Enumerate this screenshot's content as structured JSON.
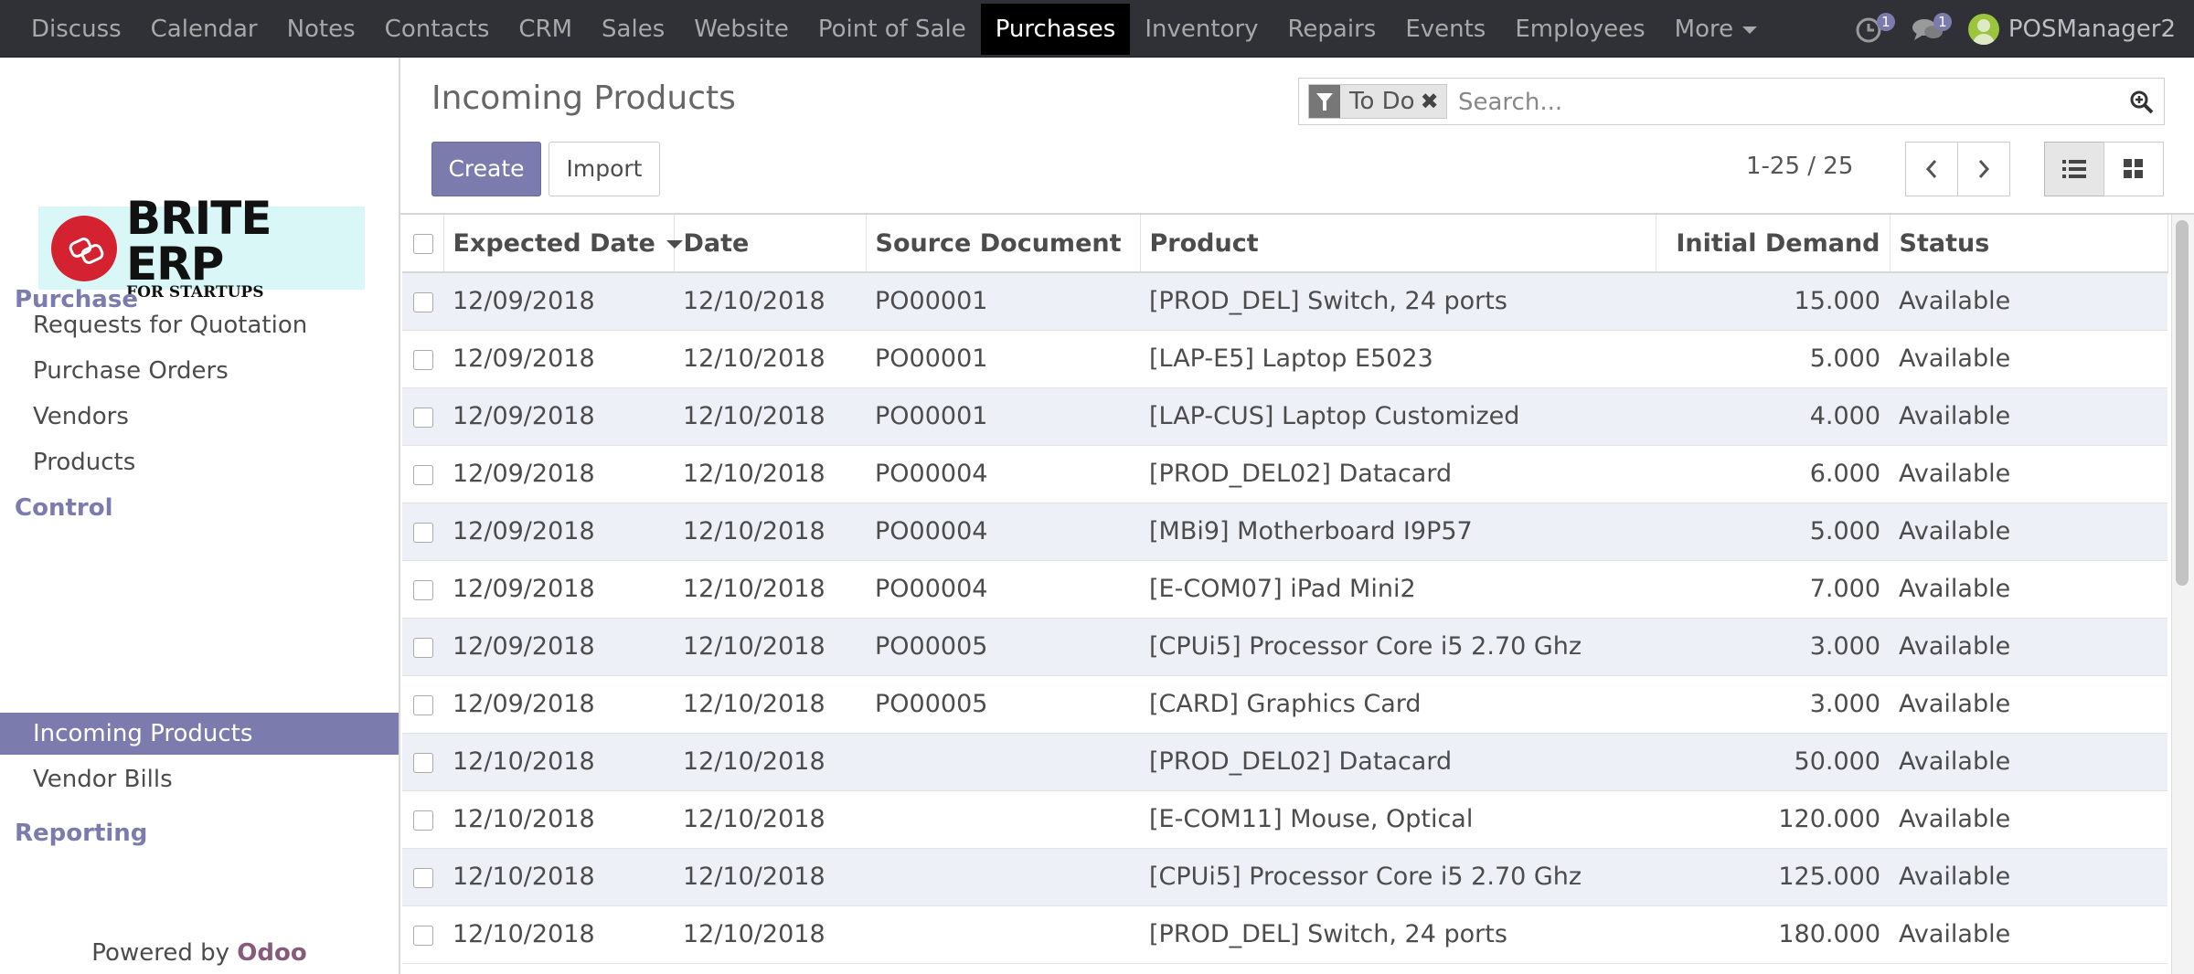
{
  "top_menu": {
    "items": [
      "Discuss",
      "Calendar",
      "Notes",
      "Contacts",
      "CRM",
      "Sales",
      "Website",
      "Point of Sale",
      "Purchases",
      "Inventory",
      "Repairs",
      "Events",
      "Employees"
    ],
    "active": "Purchases",
    "more_label": "More",
    "activity_count": "1",
    "messages_count": "1",
    "user_name": "POSManager2"
  },
  "sidebar": {
    "logo": {
      "main": "BRITE ERP",
      "sub": "FOR STARTUPS"
    },
    "sections": [
      {
        "title": "Purchase",
        "items": [
          "Requests for Quotation",
          "Purchase Orders",
          "Vendors",
          "Products"
        ]
      },
      {
        "title": "Control",
        "items": [
          "Incoming Products",
          "Vendor Bills"
        ]
      },
      {
        "title": "Reporting",
        "items": []
      }
    ],
    "active_item": "Incoming Products",
    "powered_prefix": "Powered by ",
    "powered_brand": "Odoo"
  },
  "control_panel": {
    "title": "Incoming Products",
    "create_label": "Create",
    "import_label": "Import",
    "search_facet": "To Do",
    "search_placeholder": "Search...",
    "pager": "1-25 / 25"
  },
  "table": {
    "columns": [
      "Expected Date",
      "Date",
      "Source Document",
      "Product",
      "Initial Demand",
      "Status"
    ],
    "sorted_column": "Expected Date",
    "rows": [
      [
        "12/09/2018",
        "12/10/2018",
        "PO00001",
        "[PROD_DEL] Switch, 24 ports",
        "15.000",
        "Available"
      ],
      [
        "12/09/2018",
        "12/10/2018",
        "PO00001",
        "[LAP-E5] Laptop E5023",
        "5.000",
        "Available"
      ],
      [
        "12/09/2018",
        "12/10/2018",
        "PO00001",
        "[LAP-CUS] Laptop Customized",
        "4.000",
        "Available"
      ],
      [
        "12/09/2018",
        "12/10/2018",
        "PO00004",
        "[PROD_DEL02] Datacard",
        "6.000",
        "Available"
      ],
      [
        "12/09/2018",
        "12/10/2018",
        "PO00004",
        "[MBi9] Motherboard I9P57",
        "5.000",
        "Available"
      ],
      [
        "12/09/2018",
        "12/10/2018",
        "PO00004",
        "[E-COM07] iPad Mini2",
        "7.000",
        "Available"
      ],
      [
        "12/09/2018",
        "12/10/2018",
        "PO00005",
        "[CPUi5] Processor Core i5 2.70 Ghz",
        "3.000",
        "Available"
      ],
      [
        "12/09/2018",
        "12/10/2018",
        "PO00005",
        "[CARD] Graphics Card",
        "3.000",
        "Available"
      ],
      [
        "12/10/2018",
        "12/10/2018",
        "",
        "[PROD_DEL02] Datacard",
        "50.000",
        "Available"
      ],
      [
        "12/10/2018",
        "12/10/2018",
        "",
        "[E-COM11] Mouse, Optical",
        "120.000",
        "Available"
      ],
      [
        "12/10/2018",
        "12/10/2018",
        "",
        "[CPUi5] Processor Core i5 2.70 Ghz",
        "125.000",
        "Available"
      ],
      [
        "12/10/2018",
        "12/10/2018",
        "",
        "[PROD_DEL] Switch, 24 ports",
        "180.000",
        "Available"
      ]
    ]
  },
  "colors": {
    "accent": "#7c7bad",
    "topbar": "#2f3136",
    "row_stripe": "#eef0f7",
    "brand_red": "#d42230",
    "odoo": "#875a7b"
  },
  "icons": {
    "activity": "clock-icon",
    "messages": "chat-bubble-icon",
    "search": "search-icon",
    "facet": "filter-icon"
  }
}
